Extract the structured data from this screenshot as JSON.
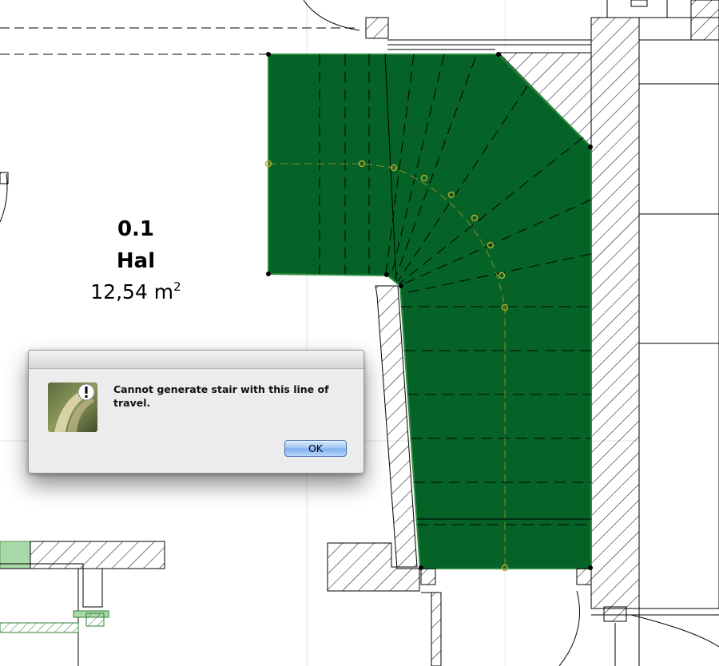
{
  "zone": {
    "number": "0.1",
    "name": "Hal",
    "area_value": "12,54 m",
    "area_unit_exponent": "2"
  },
  "alert": {
    "icon": "archicad-caution-icon",
    "message": "Cannot generate stair with this line of travel.",
    "ok_label": "OK"
  },
  "colors": {
    "stair_fill": "#056327",
    "walking_line": "#8a8a2a",
    "hatch": "#000000",
    "ok_button": "#8ab9f1"
  }
}
